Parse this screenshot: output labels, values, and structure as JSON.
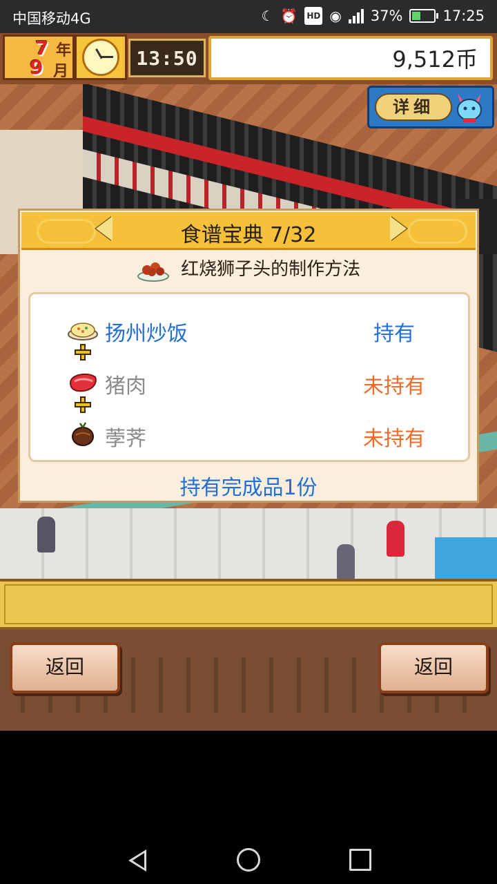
{
  "status_bar": {
    "carrier": "中国移动4G",
    "hd": "HD",
    "network": "4G",
    "battery_percent": "37%",
    "battery_level": 0.37,
    "time": "17:25",
    "icons": [
      "moon-icon",
      "alarm-icon",
      "hd-icon",
      "eye-icon",
      "signal-icon",
      "battery-charging-icon"
    ]
  },
  "hud": {
    "year_num": "7",
    "year_unit": "年",
    "month_num": "9",
    "month_unit": "月",
    "clock_icon": "clock-icon",
    "game_time": "13:50",
    "money": "9,512币",
    "detail_label": "详细"
  },
  "recipe": {
    "title": "食谱宝典 7/32",
    "dish": "红烧狮子头的制作方法",
    "ingredients": [
      {
        "name": "扬州炒饭",
        "status": "持有",
        "owned": true,
        "icon": "fried-rice-icon"
      },
      {
        "name": "猪肉",
        "status": "未持有",
        "owned": false,
        "icon": "pork-icon"
      },
      {
        "name": "荸荠",
        "status": "未持有",
        "owned": false,
        "icon": "water-chestnut-icon"
      }
    ],
    "owned_summary": "持有完成品1份"
  },
  "buttons": {
    "back_left": "返回",
    "back_right": "返回"
  },
  "colors": {
    "owned": "#1f6fd6",
    "not_owned_name": "#8a8a8a",
    "not_owned_status": "#f06a28",
    "header_gold": "#f6c13a"
  }
}
